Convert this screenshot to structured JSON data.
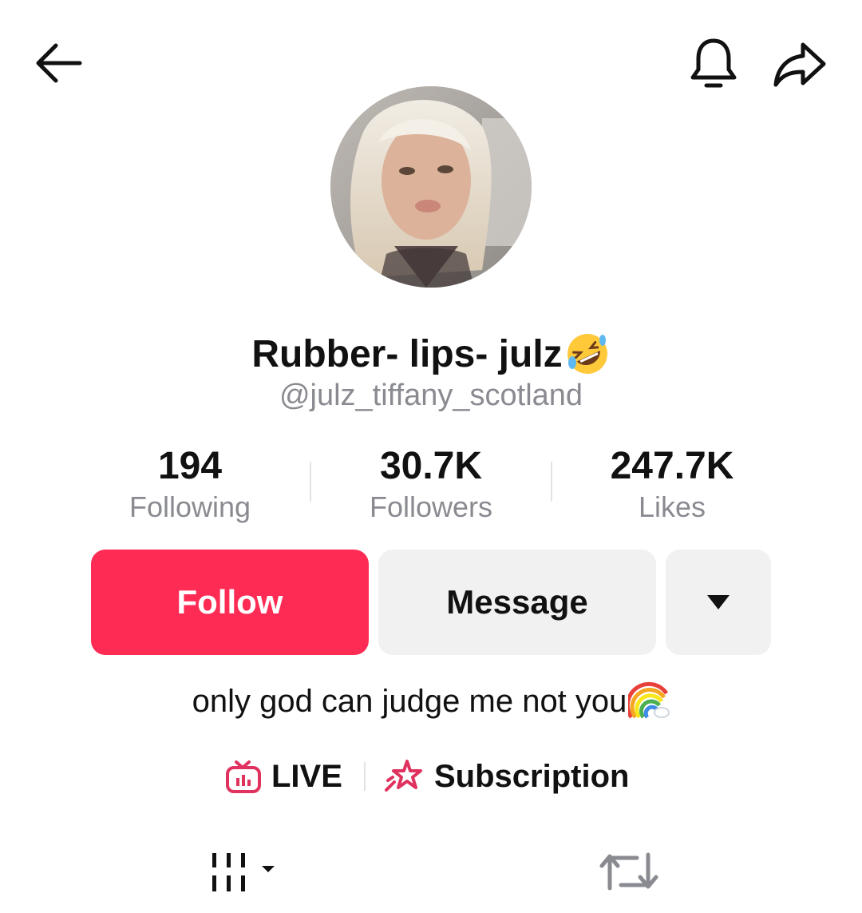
{
  "header": {
    "back_icon": "arrow-left-icon",
    "notification_icon": "bell-icon",
    "share_icon": "share-arrow-icon"
  },
  "profile": {
    "display_name": "Rubber- lips- julz",
    "display_name_emoji": "rolling-on-floor-laughing-emoji",
    "username": "@julz_tiffany_scotland",
    "avatar": "profile-photo"
  },
  "stats": [
    {
      "value": "194",
      "label": "Following"
    },
    {
      "value": "30.7K",
      "label": "Followers"
    },
    {
      "value": "247.7K",
      "label": "Likes"
    }
  ],
  "actions": {
    "follow_label": "Follow",
    "message_label": "Message",
    "more_icon": "caret-down-icon"
  },
  "bio": {
    "text": "only god can judge me not you",
    "emoji": "rainbow-emoji"
  },
  "links": {
    "live_label": "LIVE",
    "subscription_label": "Subscription"
  },
  "tabs": {
    "videos_icon": "grid-icon",
    "reposts_icon": "repost-icon"
  },
  "colors": {
    "accent": "#fe2c55",
    "secondary_button": "#f1f1f2",
    "muted_text": "#8a8b91"
  }
}
